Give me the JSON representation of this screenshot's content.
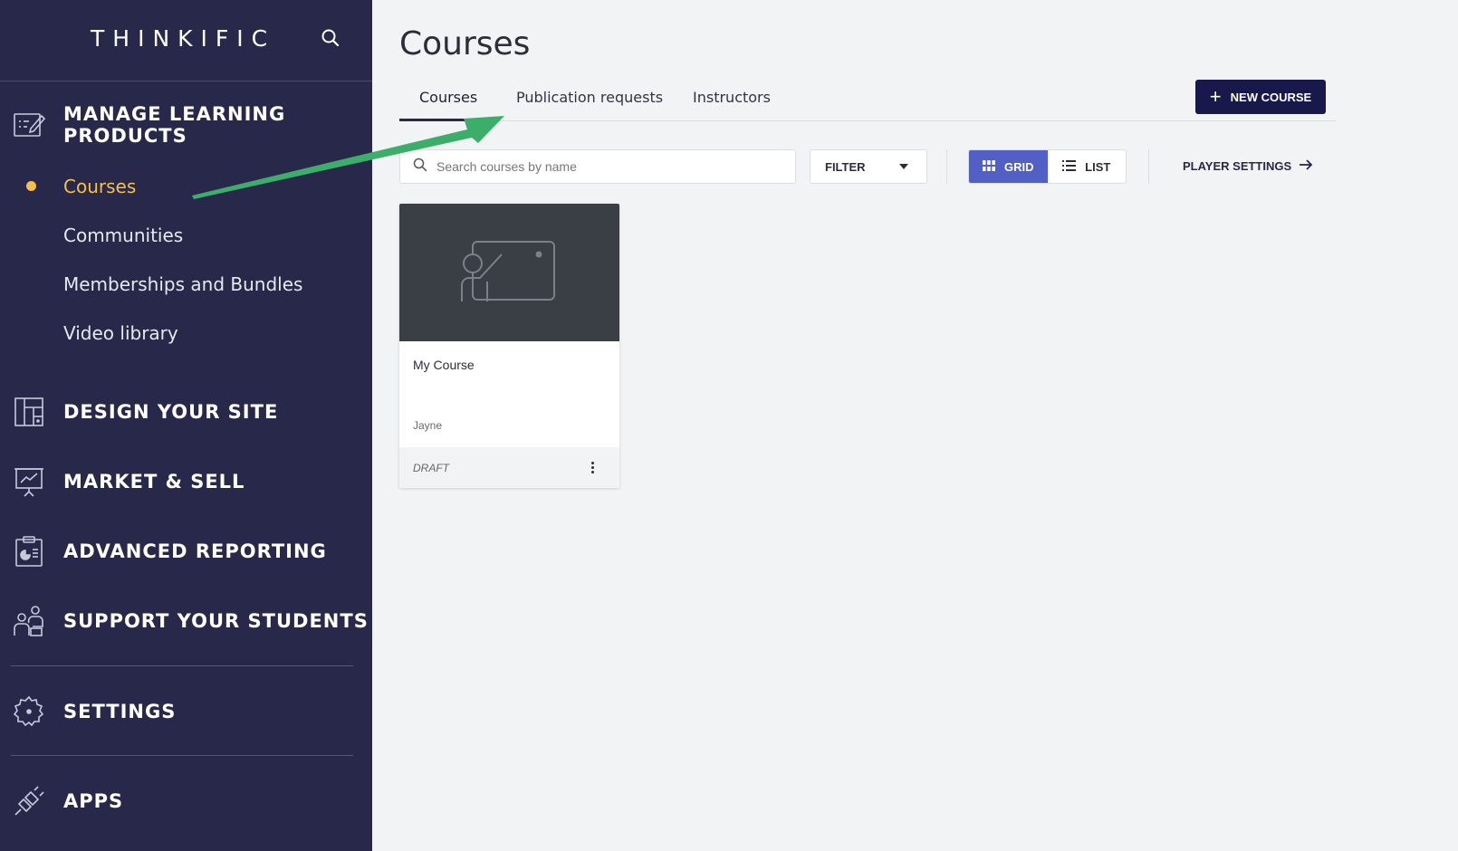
{
  "app": {
    "brand": "THINKIFIC"
  },
  "sidebar": {
    "sections": [
      {
        "label": "MANAGE LEARNING PRODUCTS",
        "icon": "edit-list-icon"
      },
      {
        "label": "DESIGN YOUR SITE",
        "icon": "layout-icon"
      },
      {
        "label": "MARKET & SELL",
        "icon": "presentation-chart-icon"
      },
      {
        "label": "ADVANCED REPORTING",
        "icon": "report-clipboard-icon"
      },
      {
        "label": "SUPPORT YOUR STUDENTS",
        "icon": "people-icon"
      },
      {
        "label": "SETTINGS",
        "icon": "gear-icon"
      },
      {
        "label": "APPS",
        "icon": "plug-icon"
      }
    ],
    "sub_items": [
      {
        "label": "Courses",
        "active": true
      },
      {
        "label": "Communities"
      },
      {
        "label": "Memberships and Bundles"
      },
      {
        "label": "Video library"
      }
    ]
  },
  "main": {
    "title": "Courses",
    "tabs": [
      {
        "label": "Courses",
        "active": true
      },
      {
        "label": "Publication requests"
      },
      {
        "label": "Instructors"
      }
    ],
    "new_course_label": "NEW COURSE",
    "search": {
      "placeholder": "Search courses by name",
      "value": ""
    },
    "filter_label": "FILTER",
    "view_toggle": {
      "grid_label": "GRID",
      "list_label": "LIST",
      "selected": "GRID"
    },
    "player_settings_label": "PLAYER SETTINGS",
    "courses": [
      {
        "title": "My Course",
        "author": "Jayne",
        "status": "DRAFT"
      }
    ]
  },
  "colors": {
    "sidebar_bg": "#28284b",
    "active_accent": "#f5c04a",
    "primary_button": "#18184a",
    "toggle_active": "#5260c6",
    "annotation_arrow": "#3dae6a"
  }
}
